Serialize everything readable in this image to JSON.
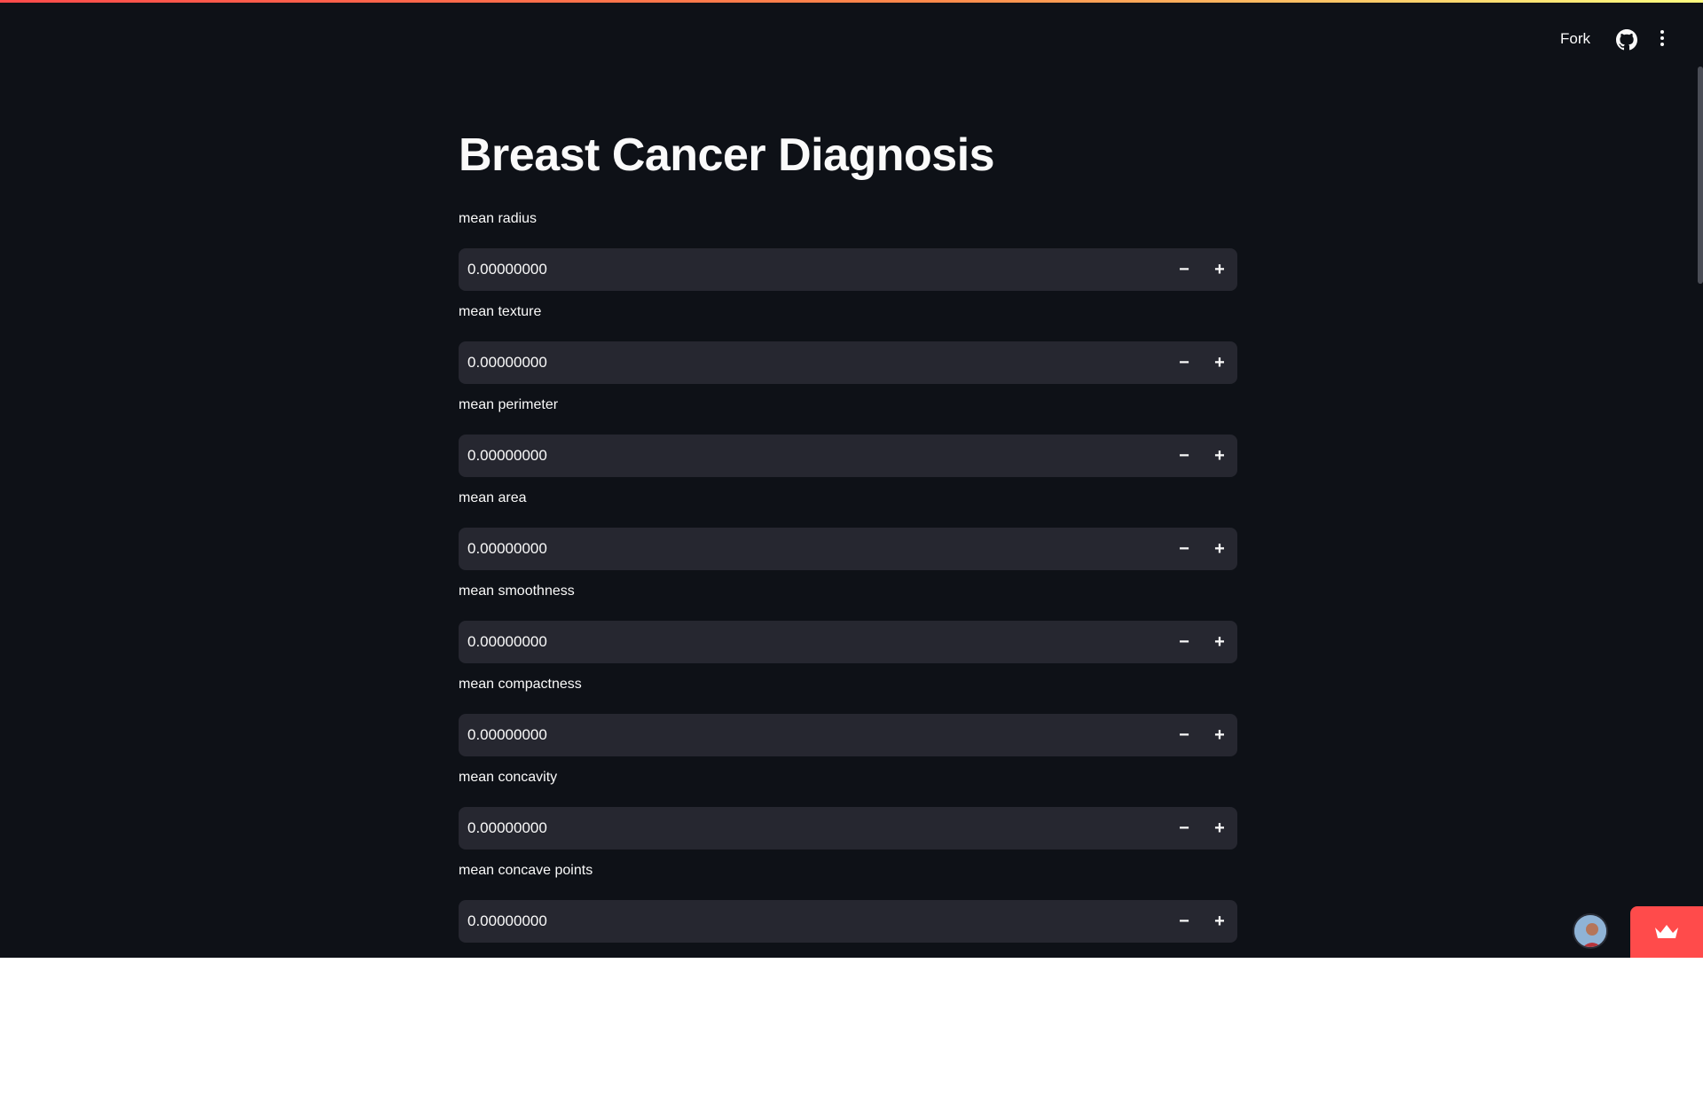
{
  "header": {
    "fork_label": "Fork",
    "github_icon": "github-icon",
    "menu_icon": "kebab-menu-icon"
  },
  "page": {
    "title": "Breast Cancer Diagnosis"
  },
  "fields": [
    {
      "label": "mean radius",
      "value": "0.00000000"
    },
    {
      "label": "mean texture",
      "value": "0.00000000"
    },
    {
      "label": "mean perimeter",
      "value": "0.00000000"
    },
    {
      "label": "mean area",
      "value": "0.00000000"
    },
    {
      "label": "mean smoothness",
      "value": "0.00000000"
    },
    {
      "label": "mean compactness",
      "value": "0.00000000"
    },
    {
      "label": "mean concavity",
      "value": "0.00000000"
    },
    {
      "label": "mean concave points",
      "value": "0.00000000"
    }
  ],
  "stepper": {
    "minus": "−",
    "plus": "+"
  },
  "colors": {
    "background": "#0e1117",
    "input_bg": "#262730",
    "accent": "#ff4b4b",
    "text": "#fafafa"
  }
}
